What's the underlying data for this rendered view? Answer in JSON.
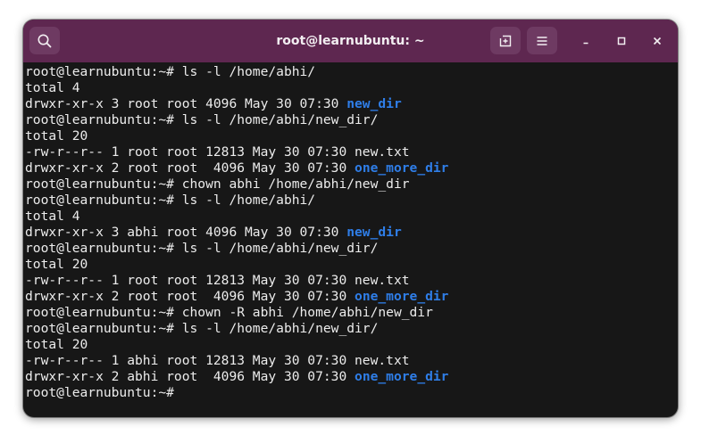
{
  "window": {
    "title": "root@learnubuntu: ~"
  },
  "colors": {
    "titlebar": "#5e2750",
    "terminal_bg": "#171717",
    "text": "#ececec",
    "directory": "#2f7ee8"
  },
  "terminal": {
    "lines": [
      [
        {
          "t": "root@learnubuntu:~# ls -l /home/abhi/"
        }
      ],
      [
        {
          "t": "total 4"
        }
      ],
      [
        {
          "t": "drwxr-xr-x 3 root root 4096 May 30 07:30 "
        },
        {
          "t": "new_dir",
          "dir": true
        }
      ],
      [
        {
          "t": "root@learnubuntu:~# ls -l /home/abhi/new_dir/"
        }
      ],
      [
        {
          "t": "total 20"
        }
      ],
      [
        {
          "t": "-rw-r--r-- 1 root root 12813 May 30 07:30 new.txt"
        }
      ],
      [
        {
          "t": "drwxr-xr-x 2 root root  4096 May 30 07:30 "
        },
        {
          "t": "one_more_dir",
          "dir": true
        }
      ],
      [
        {
          "t": "root@learnubuntu:~# chown abhi /home/abhi/new_dir"
        }
      ],
      [
        {
          "t": "root@learnubuntu:~# ls -l /home/abhi/"
        }
      ],
      [
        {
          "t": "total 4"
        }
      ],
      [
        {
          "t": "drwxr-xr-x 3 abhi root 4096 May 30 07:30 "
        },
        {
          "t": "new_dir",
          "dir": true
        }
      ],
      [
        {
          "t": "root@learnubuntu:~# ls -l /home/abhi/new_dir/"
        }
      ],
      [
        {
          "t": "total 20"
        }
      ],
      [
        {
          "t": "-rw-r--r-- 1 root root 12813 May 30 07:30 new.txt"
        }
      ],
      [
        {
          "t": "drwxr-xr-x 2 root root  4096 May 30 07:30 "
        },
        {
          "t": "one_more_dir",
          "dir": true
        }
      ],
      [
        {
          "t": "root@learnubuntu:~# chown -R abhi /home/abhi/new_dir"
        }
      ],
      [
        {
          "t": "root@learnubuntu:~# ls -l /home/abhi/new_dir/"
        }
      ],
      [
        {
          "t": "total 20"
        }
      ],
      [
        {
          "t": "-rw-r--r-- 1 abhi root 12813 May 30 07:30 new.txt"
        }
      ],
      [
        {
          "t": "drwxr-xr-x 2 abhi root  4096 May 30 07:30 "
        },
        {
          "t": "one_more_dir",
          "dir": true
        }
      ],
      [
        {
          "t": "root@learnubuntu:~# "
        }
      ]
    ]
  }
}
